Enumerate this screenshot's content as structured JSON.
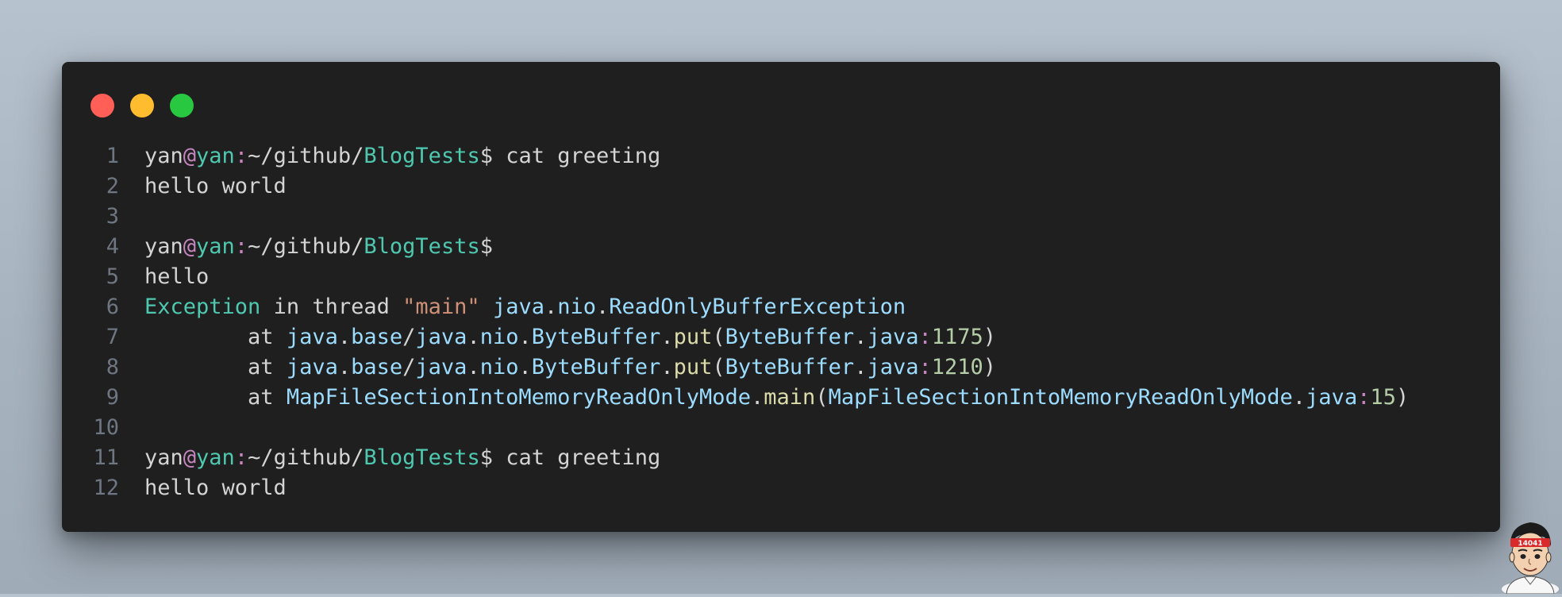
{
  "window": {
    "traffic_lights": {
      "close_color": "#ff5f57",
      "minimize_color": "#febc2e",
      "maximize_color": "#28c840"
    }
  },
  "avatar": {
    "badge_text": "14041",
    "icon": "cartoon-avatar-icon"
  },
  "code": {
    "lines": [
      {
        "number": "1",
        "tokens": [
          {
            "text": "yan",
            "kind": "user"
          },
          {
            "text": "@",
            "kind": "at"
          },
          {
            "text": "yan",
            "kind": "host"
          },
          {
            "text": ":",
            "kind": "colon"
          },
          {
            "text": "~/github/",
            "kind": "plain"
          },
          {
            "text": "BlogTests",
            "kind": "path"
          },
          {
            "text": "$ cat greeting",
            "kind": "plain"
          }
        ]
      },
      {
        "number": "2",
        "tokens": [
          {
            "text": "hello world",
            "kind": "plain"
          }
        ]
      },
      {
        "number": "3",
        "tokens": []
      },
      {
        "number": "4",
        "tokens": [
          {
            "text": "yan",
            "kind": "user"
          },
          {
            "text": "@",
            "kind": "at"
          },
          {
            "text": "yan",
            "kind": "host"
          },
          {
            "text": ":",
            "kind": "colon"
          },
          {
            "text": "~/github/",
            "kind": "plain"
          },
          {
            "text": "BlogTests",
            "kind": "path"
          },
          {
            "text": "$",
            "kind": "plain"
          }
        ]
      },
      {
        "number": "5",
        "tokens": [
          {
            "text": "hello",
            "kind": "plain"
          }
        ]
      },
      {
        "number": "6",
        "tokens": [
          {
            "text": "Exception",
            "kind": "exc"
          },
          {
            "text": " in thread ",
            "kind": "plain"
          },
          {
            "text": "\"main\"",
            "kind": "string"
          },
          {
            "text": " ",
            "kind": "plain"
          },
          {
            "text": "java",
            "kind": "type"
          },
          {
            "text": ".",
            "kind": "punct"
          },
          {
            "text": "nio",
            "kind": "type"
          },
          {
            "text": ".",
            "kind": "punct"
          },
          {
            "text": "ReadOnlyBufferException",
            "kind": "type"
          }
        ]
      },
      {
        "number": "7",
        "tokens": [
          {
            "text": "        at ",
            "kind": "plain"
          },
          {
            "text": "java",
            "kind": "type"
          },
          {
            "text": ".",
            "kind": "punct"
          },
          {
            "text": "base",
            "kind": "type"
          },
          {
            "text": "/",
            "kind": "punct"
          },
          {
            "text": "java",
            "kind": "type"
          },
          {
            "text": ".",
            "kind": "punct"
          },
          {
            "text": "nio",
            "kind": "type"
          },
          {
            "text": ".",
            "kind": "punct"
          },
          {
            "text": "ByteBuffer",
            "kind": "type"
          },
          {
            "text": ".",
            "kind": "punct"
          },
          {
            "text": "put",
            "kind": "method"
          },
          {
            "text": "(",
            "kind": "punct"
          },
          {
            "text": "ByteBuffer",
            "kind": "type"
          },
          {
            "text": ".",
            "kind": "punct"
          },
          {
            "text": "java",
            "kind": "type"
          },
          {
            "text": ":",
            "kind": "colon"
          },
          {
            "text": "1175",
            "kind": "num"
          },
          {
            "text": ")",
            "kind": "punct"
          }
        ]
      },
      {
        "number": "8",
        "tokens": [
          {
            "text": "        at ",
            "kind": "plain"
          },
          {
            "text": "java",
            "kind": "type"
          },
          {
            "text": ".",
            "kind": "punct"
          },
          {
            "text": "base",
            "kind": "type"
          },
          {
            "text": "/",
            "kind": "punct"
          },
          {
            "text": "java",
            "kind": "type"
          },
          {
            "text": ".",
            "kind": "punct"
          },
          {
            "text": "nio",
            "kind": "type"
          },
          {
            "text": ".",
            "kind": "punct"
          },
          {
            "text": "ByteBuffer",
            "kind": "type"
          },
          {
            "text": ".",
            "kind": "punct"
          },
          {
            "text": "put",
            "kind": "method"
          },
          {
            "text": "(",
            "kind": "punct"
          },
          {
            "text": "ByteBuffer",
            "kind": "type"
          },
          {
            "text": ".",
            "kind": "punct"
          },
          {
            "text": "java",
            "kind": "type"
          },
          {
            "text": ":",
            "kind": "colon"
          },
          {
            "text": "1210",
            "kind": "num"
          },
          {
            "text": ")",
            "kind": "punct"
          }
        ]
      },
      {
        "number": "9",
        "tokens": [
          {
            "text": "        at ",
            "kind": "plain"
          },
          {
            "text": "MapFileSectionIntoMemoryReadOnlyMode",
            "kind": "type"
          },
          {
            "text": ".",
            "kind": "punct"
          },
          {
            "text": "main",
            "kind": "method"
          },
          {
            "text": "(",
            "kind": "punct"
          },
          {
            "text": "MapFileSectionIntoMemoryReadOnlyMode",
            "kind": "type"
          },
          {
            "text": ".",
            "kind": "punct"
          },
          {
            "text": "java",
            "kind": "type"
          },
          {
            "text": ":",
            "kind": "colon"
          },
          {
            "text": "15",
            "kind": "num"
          },
          {
            "text": ")",
            "kind": "punct"
          }
        ]
      },
      {
        "number": "10",
        "tokens": []
      },
      {
        "number": "11",
        "tokens": [
          {
            "text": "yan",
            "kind": "user"
          },
          {
            "text": "@",
            "kind": "at"
          },
          {
            "text": "yan",
            "kind": "host"
          },
          {
            "text": ":",
            "kind": "colon"
          },
          {
            "text": "~/github/",
            "kind": "plain"
          },
          {
            "text": "BlogTests",
            "kind": "path"
          },
          {
            "text": "$ cat greeting",
            "kind": "plain"
          }
        ]
      },
      {
        "number": "12",
        "tokens": [
          {
            "text": "hello world",
            "kind": "plain"
          }
        ]
      }
    ]
  }
}
